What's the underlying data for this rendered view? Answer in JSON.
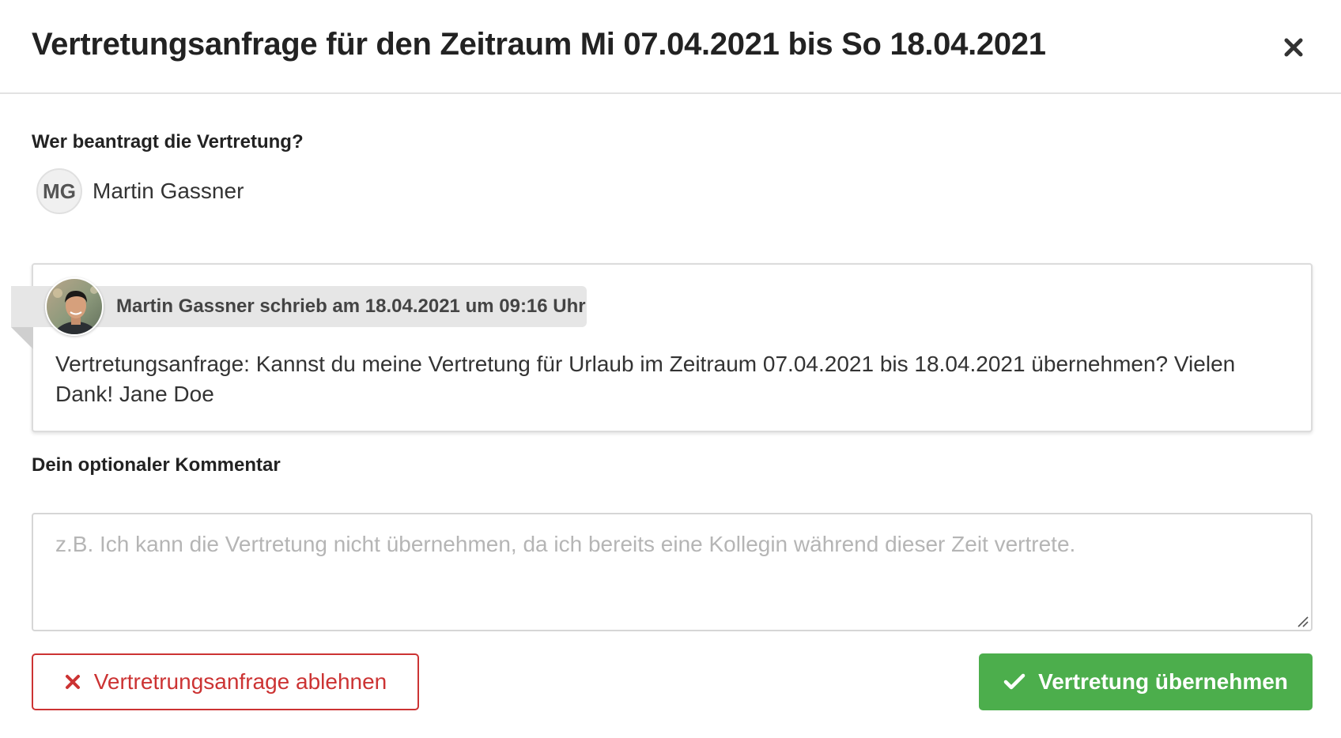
{
  "header": {
    "title": "Vertretungsanfrage für den Zeitraum Mi 07.04.2021 bis So 18.04.2021",
    "close_icon": "close-icon"
  },
  "requester": {
    "section_label": "Wer beantragt die Vertretung?",
    "initials": "MG",
    "name": "Martin Gassner"
  },
  "message": {
    "meta": "Martin Gassner schrieb am 18.04.2021 um 09:16 Uhr",
    "body": "Vertretungsanfrage: Kannst du meine Vertretung für Urlaub im Zeitraum 07.04.2021 bis 18.04.2021 übernehmen? Vielen Dank! Jane Doe",
    "avatar_icon": "user-photo-avatar"
  },
  "comment": {
    "label": "Dein optionaler Kommentar",
    "value": "",
    "placeholder": "z.B. Ich kann die Vertretung nicht übernehmen, da ich bereits eine Kollegin während dieser Zeit vertrete."
  },
  "actions": {
    "reject_label": "Vertretrungsanfrage ablehnen",
    "reject_icon": "x-icon",
    "accept_label": "Vertretung übernehmen",
    "accept_icon": "check-icon"
  },
  "colors": {
    "danger": "#cc3333",
    "success": "#4cae4c",
    "text": "#222222",
    "placeholder": "#b5b5b5"
  }
}
